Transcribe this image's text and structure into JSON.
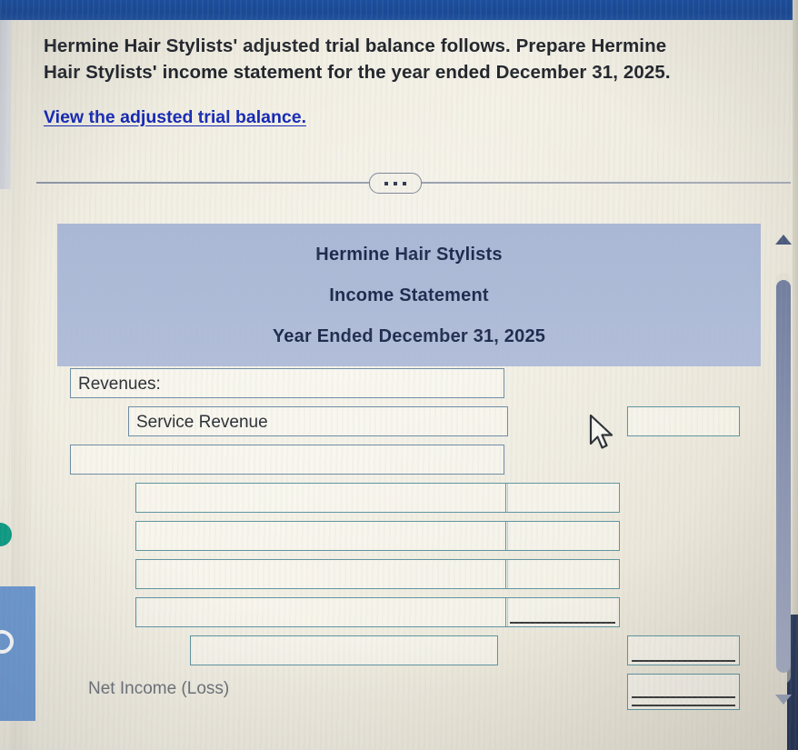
{
  "problem": {
    "line1": "Hermine Hair Stylists' adjusted trial balance follows. Prepare Hermine",
    "line2": "Hair Stylists' income statement for the year ended December 31, 2025.",
    "link_text": "View the adjusted trial balance."
  },
  "toolbar": {
    "more_options_label": "..."
  },
  "statement": {
    "company": "Hermine Hair Stylists",
    "title": "Income Statement",
    "period": "Year Ended December 31, 2025",
    "header_bg": "#adbad7",
    "rows": [
      {
        "name": "revenues-header",
        "label": "Revenues:",
        "indent": 0,
        "label_width": 478,
        "amount": "",
        "amount_col": "none",
        "rule": "none"
      },
      {
        "name": "service-revenue",
        "label": "Service Revenue",
        "indent": 1,
        "label_width": 418,
        "amount": "",
        "amount_col": "right",
        "rule": "none"
      },
      {
        "name": "blank-row-1",
        "label": "",
        "indent": 0,
        "label_width": 478,
        "amount": "",
        "amount_col": "none",
        "rule": "none"
      },
      {
        "name": "expense-row-1",
        "label": "",
        "indent": 2,
        "label_width": 410,
        "amount": "",
        "amount_col": "mid",
        "rule": "none"
      },
      {
        "name": "expense-row-2",
        "label": "",
        "indent": 2,
        "label_width": 410,
        "amount": "",
        "amount_col": "mid",
        "rule": "none"
      },
      {
        "name": "expense-row-3",
        "label": "",
        "indent": 2,
        "label_width": 410,
        "amount": "",
        "amount_col": "mid",
        "rule": "none"
      },
      {
        "name": "expense-row-4",
        "label": "",
        "indent": 2,
        "label_width": 410,
        "amount": "",
        "amount_col": "mid",
        "rule": "single"
      },
      {
        "name": "total-expenses-row",
        "label": "",
        "indent": 3,
        "label_width": 339,
        "amount": "",
        "amount_col": "right",
        "rule": "single"
      },
      {
        "name": "net-income-row",
        "label": "Net Income (Loss)",
        "indent": 0,
        "label_width": 0,
        "amount": "",
        "amount_col": "right",
        "rule": "double",
        "label_style": "plain"
      }
    ],
    "net_income_label": "Net Income (Loss)"
  },
  "scrollbar": {
    "up_arrow": "scroll-up",
    "down_arrow": "scroll-down"
  },
  "colors": {
    "top_bar": "#1a4a97",
    "link": "#1428b4",
    "cell_border": "#6e8ca4",
    "rule": "#3c3c3c"
  }
}
